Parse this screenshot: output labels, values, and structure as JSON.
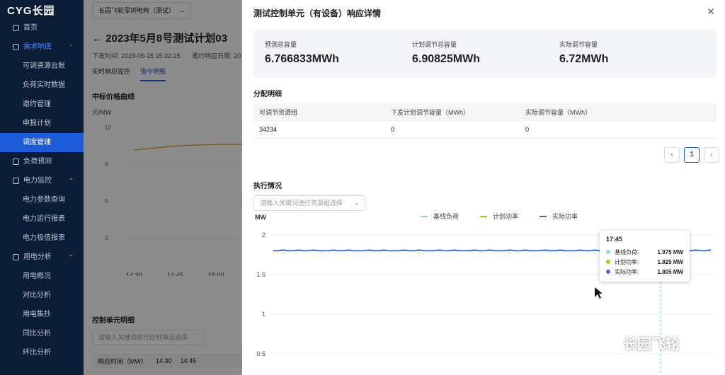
{
  "brand": "CYG长园",
  "sidebar": {
    "items": [
      {
        "label": "首页",
        "type": "top"
      },
      {
        "label": "需求响应",
        "type": "top-open"
      },
      {
        "label": "可调资源台账",
        "type": "sub"
      },
      {
        "label": "负荷实时数据",
        "type": "sub"
      },
      {
        "label": "邀约管理",
        "type": "sub"
      },
      {
        "label": "申报计划",
        "type": "sub"
      },
      {
        "label": "调度管理",
        "type": "sub-active"
      },
      {
        "label": "负荷预测",
        "type": "top"
      },
      {
        "label": "电力监控",
        "type": "top"
      },
      {
        "label": "电力参数查询",
        "type": "sub"
      },
      {
        "label": "电力运行报表",
        "type": "sub"
      },
      {
        "label": "电力极值报表",
        "type": "sub"
      },
      {
        "label": "用电分析",
        "type": "top"
      },
      {
        "label": "用电概况",
        "type": "sub"
      },
      {
        "label": "对比分析",
        "type": "sub"
      },
      {
        "label": "用电集抄",
        "type": "sub"
      },
      {
        "label": "同比分析",
        "type": "sub"
      },
      {
        "label": "环比分析",
        "type": "sub"
      }
    ]
  },
  "background": {
    "org_select": "长园飞轮深圳电网（测试）",
    "page_title": "2023年5月8号测试计划03",
    "meta_issue": "下发时间: 2023-05-15 15:02:15",
    "meta_reply": "邀约响应日期: 20",
    "tab1": "实时响应监控",
    "tab2": "指令明细",
    "section_price": "中标价格曲线",
    "price_unit": "元/MW",
    "price_ticks": [
      "12",
      "9",
      "6",
      "3"
    ],
    "price_times": [
      "14:30",
      "14:45",
      "15:00"
    ],
    "section_units": "控制单元明细",
    "units_select_placeholder": "请输入关键词进行控制单元选择",
    "table_head": [
      "响应时间（MW）",
      "14:30",
      "14:45"
    ]
  },
  "modal": {
    "title": "测试控制单元（有设备）响应详情",
    "summary": [
      {
        "label": "预测总容量",
        "value": "6.766833MWh"
      },
      {
        "label": "计划调节总容量",
        "value": "6.90825MWh"
      },
      {
        "label": "实际调节容量",
        "value": "6.72MWh"
      }
    ],
    "alloc_title": "分配明细",
    "alloc_headers": [
      "可调节资源组",
      "下发计划调节容量（MWh）",
      "实际调节容量（MWh）"
    ],
    "alloc_rows": [
      [
        "34234",
        "0",
        "0"
      ]
    ],
    "pager": {
      "prev": "‹",
      "current": "1",
      "next": "›"
    },
    "exec_title": "执行情况",
    "exec_select_placeholder": "请输入关键词进行资源组选择",
    "chart_data": {
      "type": "line",
      "ylabel": "MW",
      "y_ticks": [
        "2",
        "1.5",
        "1",
        "0.5"
      ],
      "ylim": [
        0.5,
        2
      ],
      "legend": [
        "基线负荷",
        "计划功率",
        "实际功率"
      ],
      "legend_position": "top",
      "colors": {
        "baseline": "#8fd3f4",
        "plan": "#8ed81a",
        "actual": "#3a6fd8"
      },
      "series": [
        {
          "name": "基线负荷",
          "values": [
            1.8,
            1.8,
            1.8,
            1.8,
            1.8,
            1.8,
            1.8,
            1.8,
            1.8,
            1.8,
            1.8,
            1.8,
            1.8,
            1.8,
            1.8,
            1.8,
            1.8,
            1.8,
            1.8,
            1.8,
            1.8,
            1.8,
            1.8,
            1.8,
            1.8,
            1.8,
            1.8,
            1.8,
            1.8,
            1.8,
            1.8,
            1.8,
            1.8,
            1.8,
            1.8,
            1.8,
            1.8,
            1.8,
            1.8,
            1.8,
            1.8,
            1.8,
            1.8,
            1.8,
            1.8,
            1.8,
            1.8,
            1.8,
            1.8,
            1.8,
            1.8,
            1.8,
            1.8,
            1.8,
            1.8,
            1.8,
            1.8,
            1.8,
            1.8,
            1.8,
            1.8,
            1.8,
            1.8,
            1.8,
            1.8,
            1.8,
            1.8,
            1.8,
            1.8,
            1.8,
            1.8,
            1.8,
            1.8,
            1.8,
            1.8,
            1.8,
            1.8,
            1.975,
            1.84,
            1.8,
            1.8,
            1.8,
            1.8,
            1.8,
            1.8,
            1.8,
            1.8,
            1.8
          ]
        },
        {
          "name": "计划功率",
          "values": [
            null,
            null,
            null,
            null,
            null,
            null,
            null,
            null,
            null,
            null,
            null,
            null,
            null,
            null,
            null,
            null,
            null,
            null,
            null,
            null,
            null,
            null,
            null,
            null,
            null,
            null,
            null,
            null,
            null,
            null,
            null,
            null,
            null,
            null,
            null,
            null,
            null,
            null,
            null,
            null,
            null,
            null,
            null,
            null,
            null,
            null,
            null,
            null,
            null,
            null,
            null,
            null,
            null,
            null,
            null,
            null,
            null,
            null,
            null,
            null,
            null,
            null,
            null,
            null,
            null,
            null,
            1.8,
            1.86,
            1.93,
            1.74,
            1.96,
            1.8,
            1.86,
            1.75,
            1.95,
            1.73,
            1.82,
            1.825,
            1.8,
            null,
            null,
            null,
            null,
            null,
            null,
            null,
            null,
            null
          ]
        },
        {
          "name": "实际功率",
          "values": [
            1.8,
            1.8,
            1.81,
            1.8,
            1.8,
            1.81,
            1.8,
            1.8,
            1.81,
            1.8,
            1.8,
            1.8,
            1.81,
            1.8,
            1.8,
            1.81,
            1.8,
            1.8,
            1.8,
            1.81,
            1.8,
            1.8,
            1.81,
            1.8,
            1.8,
            1.8,
            1.81,
            1.8,
            1.8,
            1.81,
            1.8,
            1.8,
            1.8,
            1.81,
            1.8,
            1.8,
            1.81,
            1.8,
            1.8,
            1.8,
            1.81,
            1.8,
            1.8,
            1.81,
            1.8,
            1.8,
            1.8,
            1.81,
            1.8,
            1.8,
            1.81,
            1.8,
            1.8,
            1.8,
            1.81,
            1.8,
            1.8,
            1.81,
            1.8,
            1.8,
            1.8,
            1.81,
            1.8,
            1.8,
            1.81,
            1.8,
            1.8,
            1.8,
            1.81,
            1.8,
            1.8,
            1.81,
            1.8,
            1.8,
            1.8,
            1.81,
            1.8,
            1.805,
            1.8,
            1.8,
            1.81,
            1.8,
            1.8,
            1.8,
            1.81,
            1.8,
            1.8,
            1.81
          ]
        }
      ]
    },
    "tooltip": {
      "time": "17:45",
      "rows": [
        {
          "label": "基线负荷:",
          "value": "1.975 MW"
        },
        {
          "label": "计划功率:",
          "value": "1.825 MW"
        },
        {
          "label": "实际功率:",
          "value": "1.805 MW"
        }
      ]
    }
  },
  "watermark": "长园飞轮"
}
